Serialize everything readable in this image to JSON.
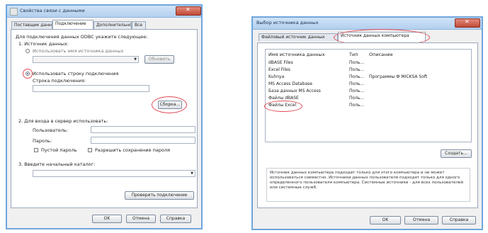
{
  "left_window": {
    "title": "Свойства связи с данными",
    "tabs": [
      "Поставщик данных",
      "Подключение",
      "Дополнительно",
      "Все"
    ],
    "active_tab": 1,
    "instruction": "Для подключения данных ODBC укажите следующее:",
    "step1_label": "1. Источник данных:",
    "radio_dsn_label": "Использовать имя источника данных",
    "refresh_button": "Обновить",
    "radio_connstr_label": "Использовать строку подключения",
    "connstr_label": "Строка подключения:",
    "build_button": "Сборка...",
    "step2_label": "2. Для входа в сервер использовать:",
    "user_label": "Пользователь:",
    "password_label": "Пароль:",
    "blank_password_label": "Пустой пароль",
    "save_password_label": "Разрешить сохранение пароля",
    "step3_label": "3. Введите начальный каталог:",
    "test_button": "Проверить подключение",
    "ok_button": "OK",
    "cancel_button": "Отмена",
    "help_button": "Справка"
  },
  "right_window": {
    "title": "Выбор источника данных",
    "tabs": [
      "Файловый источник данных",
      "Источник данных компьютера"
    ],
    "active_tab": 1,
    "columns": [
      "Имя источника данных",
      "Тип",
      "Описание"
    ],
    "rows": [
      [
        "dBASE Files",
        "Поль...",
        ""
      ],
      [
        "Excel Files",
        "Поль...",
        ""
      ],
      [
        "Kuhnya",
        "Поль...",
        "Программы Ф MICKSA Soft"
      ],
      [
        "MS Access Database",
        "Поль...",
        ""
      ],
      [
        "База данных MS Access",
        "Поль...",
        ""
      ],
      [
        "Файлы dBASE",
        "Поль...",
        ""
      ],
      [
        "Файлы Excel",
        "Поль...",
        ""
      ]
    ],
    "create_button": "Создать...",
    "info_text": "Источник данных компьютера подходит только для этого компьютера и не может использоваться совместно. Источники данных пользователя подходят только для одного определенного пользователя компьютера. Системные источники - для всех пользователей или системные служб.",
    "ok_button": "OK",
    "cancel_button": "Отмена",
    "help_button": "Справка"
  },
  "colors": {
    "highlight_circle": "#e04b56",
    "window_border": "#6fa6dc"
  }
}
